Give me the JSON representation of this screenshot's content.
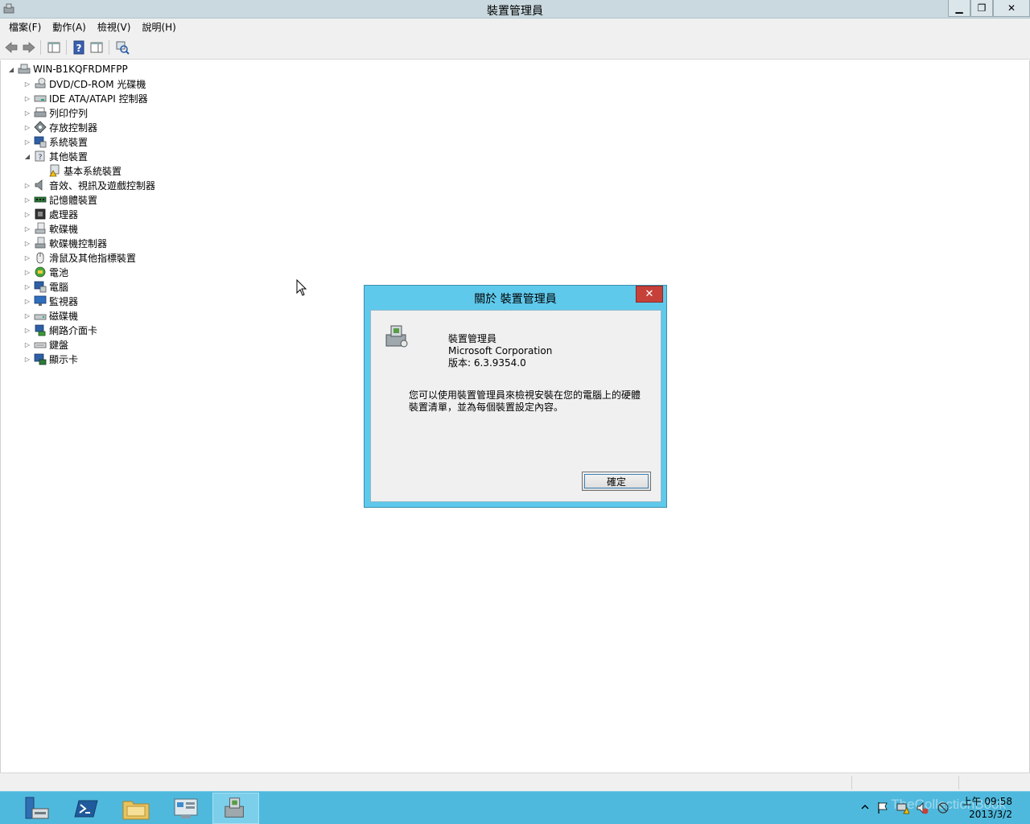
{
  "window": {
    "title": "裝置管理員",
    "minimize": "▁",
    "restore": "❐",
    "close": "✕"
  },
  "menu": {
    "items": [
      "檔案(F)",
      "動作(A)",
      "檢視(V)",
      "說明(H)"
    ]
  },
  "toolbar": {
    "icons": [
      "back-icon",
      "forward-icon",
      "show-hide-console-tree-icon",
      "help-icon",
      "properties-pane-icon",
      "scan-hardware-icon"
    ]
  },
  "tree": {
    "root": "WIN-B1KQFRDMFPP",
    "items": [
      {
        "label": "DVD/CD-ROM 光碟機",
        "icon": "dvd-drive-icon",
        "expander": "▷"
      },
      {
        "label": "IDE ATA/ATAPI 控制器",
        "icon": "ide-controller-icon",
        "expander": "▷"
      },
      {
        "label": "列印佇列",
        "icon": "printer-icon",
        "expander": "▷"
      },
      {
        "label": "存放控制器",
        "icon": "storage-controller-icon",
        "expander": "▷"
      },
      {
        "label": "系統裝置",
        "icon": "system-device-icon",
        "expander": "▷"
      },
      {
        "label": "其他裝置",
        "icon": "other-device-icon",
        "expander": "◢"
      },
      {
        "label": "基本系統裝置",
        "icon": "warning-device-icon",
        "expander": ""
      },
      {
        "label": "音效、視訊及遊戲控制器",
        "icon": "speaker-icon",
        "expander": "▷"
      },
      {
        "label": "記憶體裝置",
        "icon": "memory-icon",
        "expander": "▷"
      },
      {
        "label": "處理器",
        "icon": "processor-icon",
        "expander": "▷"
      },
      {
        "label": "軟碟機",
        "icon": "floppy-drive-icon",
        "expander": "▷"
      },
      {
        "label": "軟碟機控制器",
        "icon": "floppy-controller-icon",
        "expander": "▷"
      },
      {
        "label": "滑鼠及其他指標裝置",
        "icon": "mouse-icon",
        "expander": "▷"
      },
      {
        "label": "電池",
        "icon": "battery-icon",
        "expander": "▷"
      },
      {
        "label": "電腦",
        "icon": "computer-icon",
        "expander": "▷"
      },
      {
        "label": "監視器",
        "icon": "monitor-icon",
        "expander": "▷"
      },
      {
        "label": "磁碟機",
        "icon": "disk-drive-icon",
        "expander": "▷"
      },
      {
        "label": "網路介面卡",
        "icon": "network-adapter-icon",
        "expander": "▷"
      },
      {
        "label": "鍵盤",
        "icon": "keyboard-icon",
        "expander": "▷"
      },
      {
        "label": "顯示卡",
        "icon": "display-adapter-icon",
        "expander": "▷"
      }
    ]
  },
  "dialog": {
    "title": "關於 裝置管理員",
    "close": "✕",
    "product": "裝置管理員",
    "company": "Microsoft Corporation",
    "version": "版本: 6.3.9354.0",
    "description": "您可以使用裝置管理員來檢視安裝在您的電腦上的硬體裝置清單，並為每個裝置設定內容。",
    "ok": "確定"
  },
  "taskbar": {
    "apps": [
      "server-manager-icon",
      "powershell-icon",
      "file-explorer-icon",
      "control-panel-icon",
      "device-manager-icon"
    ],
    "time": "上午 09:58",
    "date": "2013/3/2",
    "watermark": "TheCollectionBook"
  },
  "colors": {
    "titlebar": "#c9d9df",
    "dialog_frame": "#5fc9ec",
    "taskbar": "#4fb9dd",
    "close_button": "#c6403a"
  }
}
